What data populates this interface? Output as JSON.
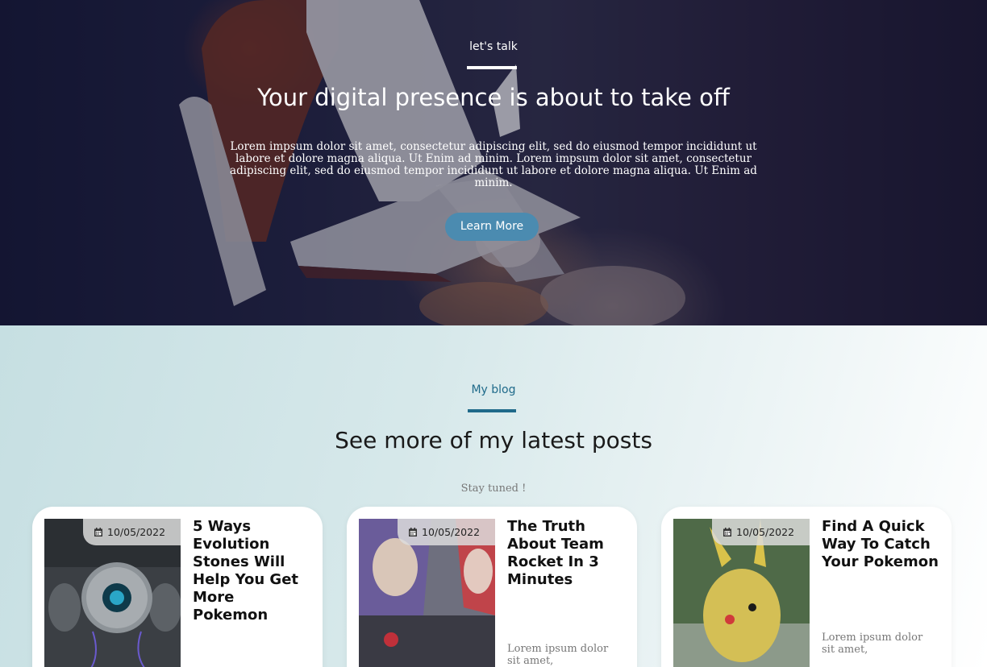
{
  "hero": {
    "kicker": "let's talk",
    "title": "Your digital presence is about to take off",
    "text": "Lorem impsum dolor sit amet, consectetur adipiscing elit, sed do eiusmod tempor incididunt ut labore et dolore magna aliqua. Ut Enim ad minim. Lorem impsum dolor sit amet, consectetur adipiscing elit, sed do eiusmod tempor incididunt ut labore et dolore magna aliqua. Ut Enim ad minim.",
    "button_label": "Learn More"
  },
  "blog": {
    "kicker": "My blog",
    "title": "See more of my latest posts",
    "subtitle": "Stay tuned !",
    "posts": [
      {
        "date": "10/05/2022",
        "title": "5 Ways Evolution Stones Will Help You Get More Pokemon",
        "excerpt": ""
      },
      {
        "date": "10/05/2022",
        "title": "The Truth About Team Rocket In 3 Minutes",
        "excerpt": "Lorem ipsum dolor sit amet,"
      },
      {
        "date": "10/05/2022",
        "title": "Find A Quick Way To Catch Your Pokemon",
        "excerpt": "Lorem ipsum dolor sit amet,"
      }
    ]
  },
  "colors": {
    "accent": "#1f6a8a",
    "button": "#4b8bb0",
    "hero_bg": "#242645"
  },
  "icons": [
    "calendar-icon"
  ]
}
